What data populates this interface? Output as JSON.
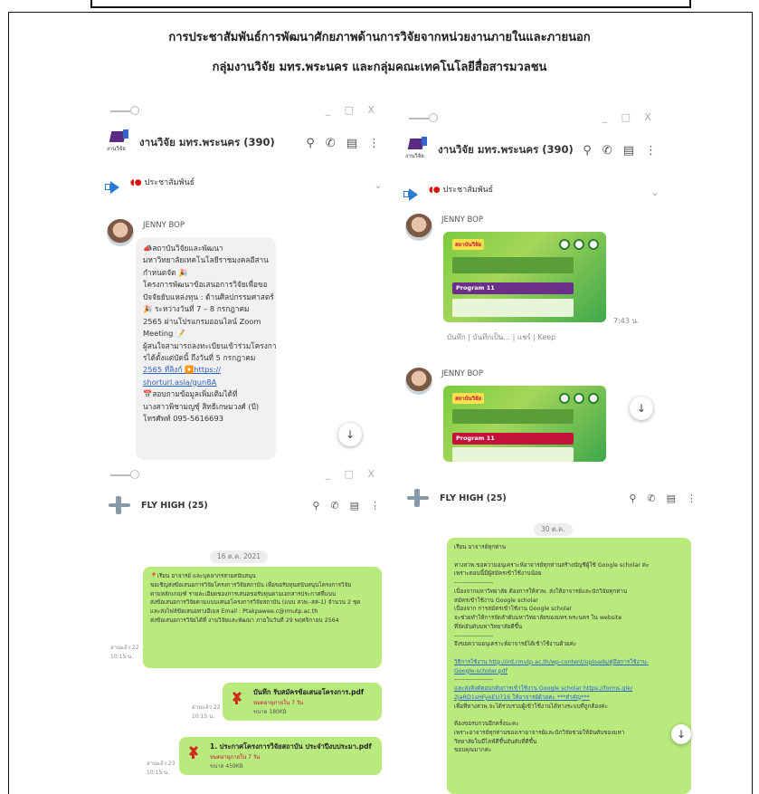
{
  "document": {
    "title_line1": "การประชาสัมพันธ์การพัฒนาศักยภาพด้านการวิจัยจากหน่วยงานภายในและภายนอก",
    "title_line2": "กลุ่มงานวิจัย มทร.พระนคร และกลุ่มคณะเทคโนโลยีสื่อสารมวลชน"
  },
  "window_controls": "_ □ X",
  "shot_a": {
    "chat_name": "งานวิจัย มทร.พระนคร (390)",
    "logo_text": "งานวิจัย",
    "pinned": "ประชาสัมพันธ์",
    "sender": "JENNY BOP",
    "message_lines": [
      "📣สถาบันวิจัยและพัฒนา",
      "มหาวิทยาลัยเทคโนโลยีราชมงคลอีสาน",
      "กำหนดจัด 🎉",
      "โครงการพัฒนาข้อเสนอการวิจัยเพื่อขอ",
      "ปัจจัยยับแหล่งทุน : ด้านศิลปกรรมศาสตร์",
      "🎉 ระหว่างวันที่ 7 – 8 กรกฎาคม",
      "2565 ผ่านโปรแกรมออนไลน์ Zoom",
      "Meeting 📝",
      "ผู้สนใจสามารถลงทะเบียนเข้าร่วมโครงกา",
      "รได้ตั้งแต่บัดนี้ ถึงวันที่ 5 กรกฎาคม",
      "2565 ที่ลิงก์ ▶️https://",
      "shorturl.asia/gun8A",
      "📅สอบถามข้อมูลเพิ่มเติมได้ที่",
      "นางสาวพิชามญชุ์ สิทธิเกษมวงศ์ (บี)",
      "โทรศัพท์ 095-5616693"
    ],
    "link_line_indices": [
      10,
      11
    ]
  },
  "shot_b": {
    "chat_name": "งานวิจัย มทร.พระนคร (390)",
    "logo_text": "งานวิจัย",
    "pinned": "ประชาสัมพันธ์",
    "sender1": "JENNY BOP",
    "sender2": "JENNY BOP",
    "time": "7:43 น.",
    "actions": "บันทึก | บันทึกเป็น... | แชร์ | Keep",
    "poster1_program": "Program 11",
    "poster2_program": "Program 11"
  },
  "shot_c": {
    "chat_name": "FLY HIGH (25)",
    "date": "16 ต.ค. 2021",
    "read1": "อ่านแล้ว 22\n10:15 น.",
    "read2": "อ่านแล้ว 22\n10:15 น.",
    "read3": "อ่านแล้ว 23\n10:15 น.",
    "message_lines": [
      "📍เรียน อาจารย์ และบุคลากรสายสนับสนุน",
      "ขอเชิญส่งข้อเสนอการวิจัยโครงการวิจัยสถาบัน เพื่อขอรับทุนสนับสนุนโครงการวิจัย",
      "ตามหลักเกณฑ์ รายละเอียดของการเสนอขอรับทุนตามเอกสารประกาศที่แนบ",
      "ส่งข้อเสนอการวิจัยตามแบบเสนอโครงการวิจัยสถาบัน (แบบ สวพ.-สส-1) จำนวน 2 ชุด",
      "และส่งไฟล์ข้อเสนอทางอีเมล Email : Ptakpawee.c@rmutp.ac.th",
      "ส่งข้อเสนอการวิจัยได้ที่ งานวิจัยและพัฒนา ภายในวันที่ 29 พฤศจิกายน 2564"
    ],
    "pdf1_name": "บันทึก รับสมัครข้อเสนอโครงการ.pdf",
    "pdf1_sub": "หมดอายุภายใน 7 วัน",
    "pdf1_size": "ขนาด 180KB",
    "pdf2_name": "1. ประกาศโครงการวิจัยสถาบัน ประจำปีงบประมา.pdf",
    "pdf2_sub": "หมดอายุภายใน 7 วัน",
    "pdf2_size": "ขนาด 459KB"
  },
  "shot_d": {
    "chat_name": "FLY HIGH (25)",
    "date": "30 ต.ค.",
    "message_lines": [
      "เรียน อาจารย์ทุกท่าน",
      "",
      "ทางสวพ.ขอความอนุเคราะห์อาจารย์ทุกท่านสร้างบัญชีผู้ใช้ Google scholar ค่ะ",
      "เพราะตอนนี้มีผู้สมัครเข้าใช้งานน้อย",
      "-------------------",
      "เนื่องจากมหาวิทยาลัย ต้องการให้สวพ. ส่งให้อาจารย์และนักวิจัยทุกท่าน",
      "สมัครเข้าใช้งาน Google scholar",
      "เนื่องจาก การสมัครเข้าใช้งาน Google scholar",
      "จะช่วยทำให้การจัดลำดับมหาวิทยาลัยของมทร.พระนคร ใน website",
      "ที่จัดอันดับมหาวิทยาลัยดีขึ้น",
      "-------------------",
      "จึงขอความอนุเคราะห์อาจารย์ได้เข้าใช้งานด้วยค่ะ",
      "",
      "วิธีการใช้งาน http://ird.rmutp.ac.th/wp-content/uploads/คู่มือการใช้งาน-",
      "Google-scholar.pdf",
      "-------------------",
      "และส่งลิงค์ตอบกลับการเข้าใช้งาน Google scholar  https://forms.gle/",
      "2jaRD1sHFyoEU716 ให้อาจารย์ด้วยค่ะ ***สำคัญ***",
      "เพื่อที่ทางสวพ.จะได้รวบรวมผู้เข้าใช้งานได้ทางระบบที่ถูกต้องค่ะ",
      "",
      "ต้องขอรบกวนอีกครั้งนะคะ",
      "เพราะอาจารย์ทุกท่านของเราอาจารย์และนักวิจัยช่วยให้อันดับของมหา",
      "วิทยาลัยในมีไลฟ์ดีขึ้นอันดับที่ดีขึ้น",
      "ขอบคุณมากค่ะ"
    ],
    "link_line_indices": [
      13,
      14,
      16,
      17
    ]
  }
}
